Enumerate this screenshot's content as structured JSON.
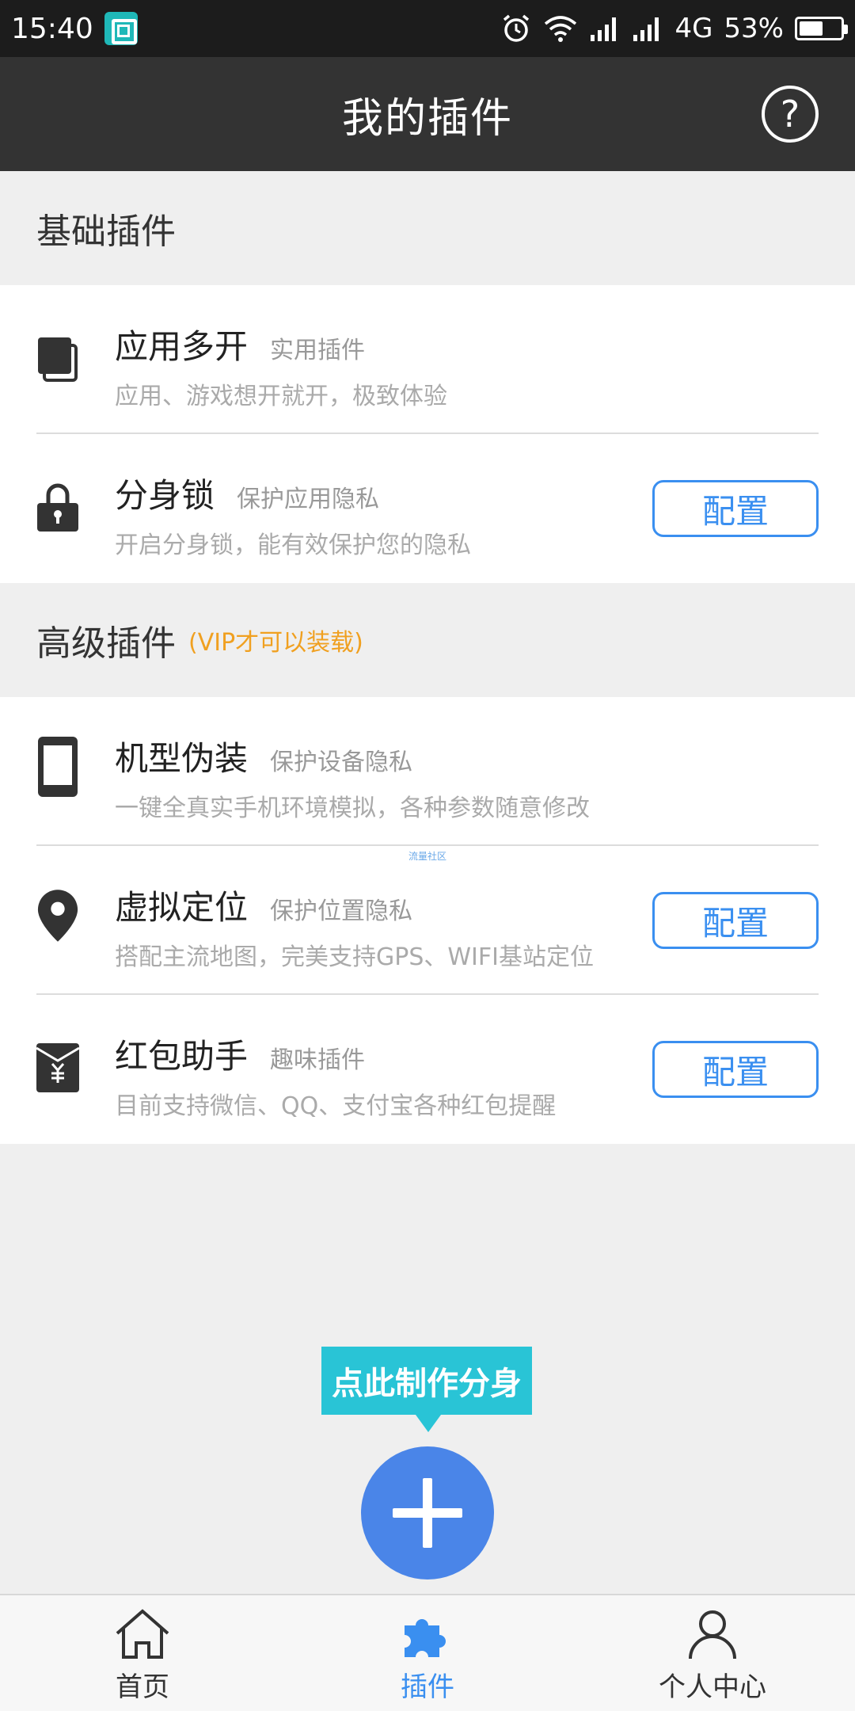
{
  "status_bar": {
    "time": "15:40",
    "network": "4G",
    "battery_percent": "53%",
    "battery_level": 0.53,
    "icons": [
      "screenshot-scan-icon",
      "alarm-icon",
      "wifi-icon",
      "signal-icon",
      "signal-icon-2",
      "battery-icon"
    ]
  },
  "header": {
    "title": "我的插件",
    "help_label": "?"
  },
  "basic_section": {
    "title": "基础插件",
    "items": [
      {
        "name": "应用多开",
        "tag": "实用插件",
        "desc": "应用、游戏想开就开，极致体验",
        "icon": "multi-window-icon"
      },
      {
        "name": "分身锁",
        "tag": "保护应用隐私",
        "desc": "开启分身锁，能有效保护您的隐私",
        "icon": "lock-icon",
        "button": "配置"
      }
    ]
  },
  "advanced_section": {
    "title": "高级插件",
    "note": "(VIP才可以装载)",
    "items": [
      {
        "name": "机型伪装",
        "tag": "保护设备隐私",
        "desc": "一键全真实手机环境模拟，各种参数随意修改",
        "icon": "phone-icon"
      },
      {
        "name": "虚拟定位",
        "tag": "保护位置隐私",
        "desc": "搭配主流地图，完美支持GPS、WIFI基站定位",
        "icon": "location-pin-icon",
        "button": "配置"
      },
      {
        "name": "红包助手",
        "tag": "趣味插件",
        "desc": "目前支持微信、QQ、支付宝各种红包提醒",
        "icon": "red-envelope-icon",
        "button": "配置"
      }
    ],
    "watermark": "流量社区"
  },
  "create_clone": {
    "bubble_text": "点此制作分身"
  },
  "bottom_nav": {
    "items": [
      {
        "label": "首页",
        "icon": "home-icon",
        "active": false
      },
      {
        "label": "插件",
        "icon": "puzzle-icon",
        "active": true
      },
      {
        "label": "个人中心",
        "icon": "user-icon",
        "active": false
      }
    ]
  },
  "colors": {
    "accent": "#3a8ff0",
    "title_bar": "#333333",
    "vip_note": "#f0a020",
    "bubble": "#29c4d6",
    "fab": "#4a85e8"
  }
}
